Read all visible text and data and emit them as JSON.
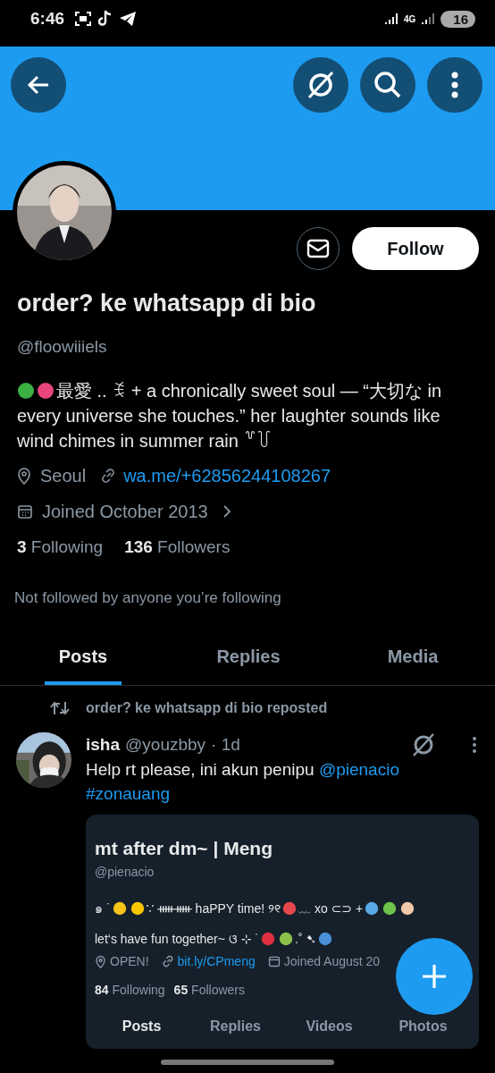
{
  "status_bar": {
    "time": "6:46",
    "network": "4G",
    "battery": "16"
  },
  "profile": {
    "name": "order? ke whatsapp di bio",
    "handle": "@floowiiiels",
    "bio_segments": [
      {
        "kind": "emoji",
        "color": "#3cb043"
      },
      {
        "kind": "emoji",
        "color": "#e8457a"
      },
      {
        "kind": "text",
        "text": "最愛 .. ꉂ + a chronically sweet soul — “大切な in every universe she touches.” her laughter sounds like wind chimes in summer rain ꒷꒦"
      }
    ],
    "location": "Seoul",
    "link": "wa.me/+62856244108267",
    "joined": "Joined October 2013",
    "following_count": "3",
    "following_label": "Following",
    "followers_count": "136",
    "followers_label": "Followers",
    "follow_button": "Follow",
    "not_followed": "Not followed by anyone you’re following"
  },
  "tabs": [
    {
      "label": "Posts",
      "selected": true
    },
    {
      "label": "Replies",
      "selected": false
    },
    {
      "label": "Media",
      "selected": false
    }
  ],
  "post": {
    "repost_line": "order? ke whatsapp di bio reposted",
    "author": "isha",
    "handle": "@youzbby",
    "time": "· 1d",
    "text": "Help rt please, ini akun penipu ",
    "mention": "@pienacio",
    "hashtag": "#zonauang",
    "card": {
      "name": "mt after dm~ | Meng",
      "handle": "@pienacio",
      "bio_lines": [
        [
          {
            "kind": "text",
            "text": "๑ ˙"
          },
          {
            "kind": "emoji",
            "color": "#f5c518"
          },
          {
            "kind": "emoji",
            "color": "#f7c600"
          },
          {
            "kind": "text",
            "text": "∵ ᚔᚔ haPPY time! ୨୧"
          },
          {
            "kind": "emoji",
            "color": "#e5484d"
          },
          {
            "kind": "text",
            "text": "﹏ xo ⊂⊃ +"
          },
          {
            "kind": "emoji",
            "color": "#5aa9e6"
          },
          {
            "kind": "emoji",
            "color": "#6cc24a"
          },
          {
            "kind": "emoji",
            "color": "#f1c7a8"
          }
        ],
        [
          {
            "kind": "text",
            "text": "let‘s have fun together~ ଓ ⊹ ˙"
          },
          {
            "kind": "emoji",
            "color": "#e0303f"
          },
          {
            "kind": "emoji",
            "color": "#8bc34a"
          },
          {
            "kind": "text",
            "text": ".˚ ➷"
          },
          {
            "kind": "emoji",
            "color": "#4a90d9"
          }
        ]
      ],
      "location": "OPEN!",
      "link": "bit.ly/CPmeng",
      "joined": "Joined August 20",
      "following_count": "84",
      "following_label": "Following",
      "followers_count": "65",
      "followers_label": "Followers",
      "tabs": [
        {
          "label": "Posts",
          "selected": true
        },
        {
          "label": "Replies",
          "selected": false
        },
        {
          "label": "Videos",
          "selected": false
        },
        {
          "label": "Photos",
          "selected": false
        }
      ]
    }
  }
}
